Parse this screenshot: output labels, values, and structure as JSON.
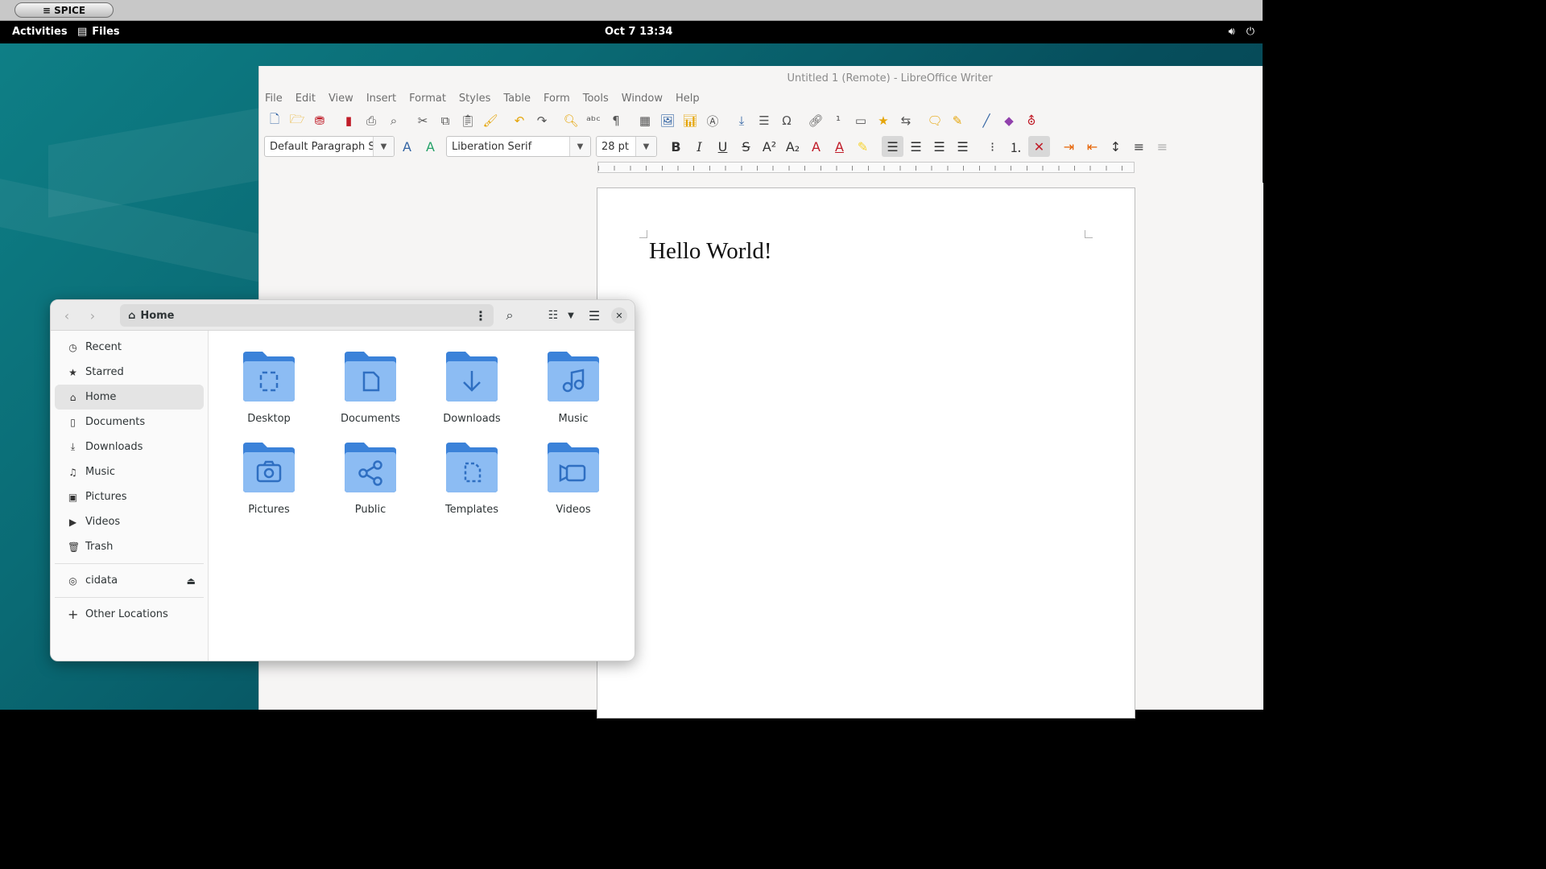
{
  "spice": {
    "label": "≡ SPICE"
  },
  "topbar": {
    "activities": "Activities",
    "app_name": "Files",
    "clock": "Oct 7  13:34"
  },
  "libreoffice": {
    "title": "Untitled 1 (Remote) - LibreOffice Writer",
    "menu": [
      "File",
      "Edit",
      "View",
      "Insert",
      "Format",
      "Styles",
      "Table",
      "Form",
      "Tools",
      "Window",
      "Help"
    ],
    "paragraph_style": "Default Paragraph Style",
    "font_name": "Liberation Serif",
    "font_size": "28 pt",
    "document_text": "Hello World!"
  },
  "files": {
    "path": "Home",
    "sidebar": [
      {
        "label": "Recent",
        "icon": "clock-icon"
      },
      {
        "label": "Starred",
        "icon": "star-icon"
      },
      {
        "label": "Home",
        "icon": "home-icon",
        "selected": true
      },
      {
        "label": "Documents",
        "icon": "document-icon"
      },
      {
        "label": "Downloads",
        "icon": "download-icon"
      },
      {
        "label": "Music",
        "icon": "music-icon"
      },
      {
        "label": "Pictures",
        "icon": "picture-icon"
      },
      {
        "label": "Videos",
        "icon": "video-icon"
      },
      {
        "label": "Trash",
        "icon": "trash-icon"
      }
    ],
    "devices": [
      {
        "label": "cidata",
        "icon": "disc-icon"
      }
    ],
    "other": {
      "label": "Other Locations"
    },
    "folders": [
      {
        "label": "Desktop",
        "icon": "desktop-icon"
      },
      {
        "label": "Documents",
        "icon": "document-icon"
      },
      {
        "label": "Downloads",
        "icon": "download-icon"
      },
      {
        "label": "Music",
        "icon": "music-icon"
      },
      {
        "label": "Pictures",
        "icon": "camera-icon"
      },
      {
        "label": "Public",
        "icon": "share-icon"
      },
      {
        "label": "Templates",
        "icon": "template-icon"
      },
      {
        "label": "Videos",
        "icon": "video-icon"
      }
    ],
    "folder_color": "#5e9ee8"
  }
}
